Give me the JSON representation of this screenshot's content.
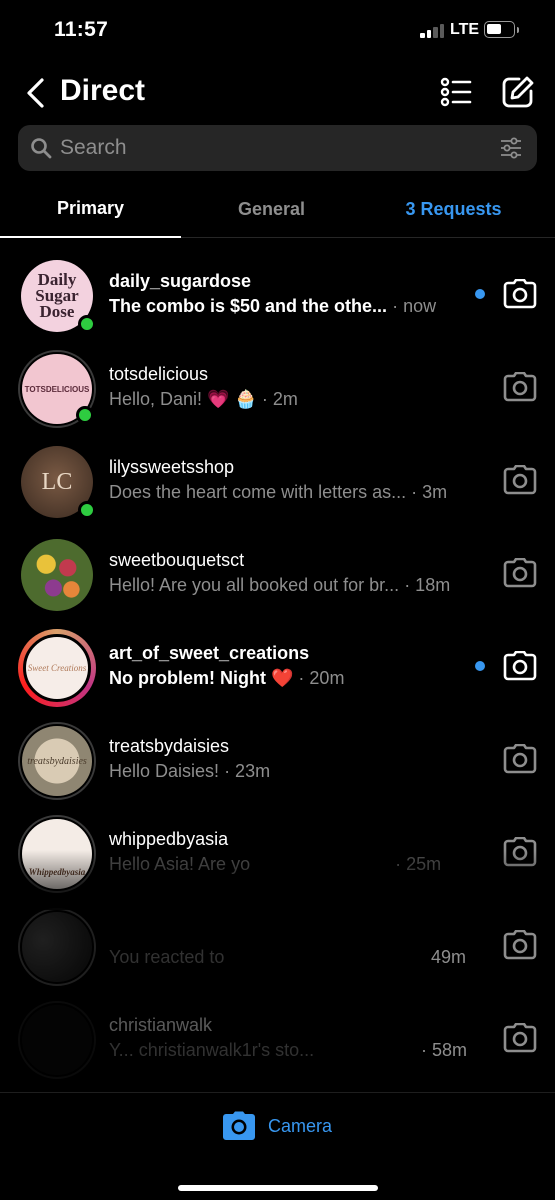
{
  "status_bar": {
    "time": "11:57",
    "network": "LTE"
  },
  "header": {
    "title": "Direct"
  },
  "search": {
    "placeholder": "Search"
  },
  "tabs": {
    "primary": "Primary",
    "general": "General",
    "requests": "3 Requests"
  },
  "threads": [
    {
      "username": "daily_sugardose",
      "preview": "The combo is $50 and the othe...",
      "time": "· now",
      "unread": true,
      "online": true,
      "avatar_text": "Daily Sugar Dose"
    },
    {
      "username": "totsdelicious",
      "preview": "Hello, Dani! 💗 🧁",
      "time": "· 2m",
      "unread": false,
      "online": true,
      "avatar_text": "TOTSDELICIOUS"
    },
    {
      "username": "lilyssweetsshop",
      "preview": "Does the heart come with letters as...",
      "time": "· 3m",
      "unread": false,
      "online": true,
      "avatar_text": "LC"
    },
    {
      "username": "sweetbouquetsct",
      "preview": "Hello! Are you all booked out for br...",
      "time": "· 18m",
      "unread": false,
      "online": false,
      "avatar_text": ""
    },
    {
      "username": "art_of_sweet_creations",
      "preview": "No problem! Night ❤️",
      "time": "· 20m",
      "unread": true,
      "online": false,
      "avatar_text": "Sweet Creations"
    },
    {
      "username": "treatsbydaisies",
      "preview": "Hello Daisies!",
      "time": "· 23m",
      "unread": false,
      "online": false,
      "avatar_text": "treatsbydaisies"
    },
    {
      "username": "whippedbyasia",
      "preview": "Hello Asia! Are yo",
      "time": "· 25m",
      "unread": false,
      "online": false,
      "avatar_text": "Whippedbyasia"
    },
    {
      "username": "",
      "preview": "You reacted to",
      "time": "49m",
      "unread": false,
      "online": false,
      "avatar_text": ""
    },
    {
      "username": "christianwalk",
      "preview": "Y... christianwalk1r's sto...",
      "time": "· 58m",
      "unread": false,
      "online": false,
      "avatar_text": ""
    }
  ],
  "bottom": {
    "camera_label": "Camera"
  },
  "colors": {
    "background": "#000000",
    "accent": "#3897f0",
    "online": "#2ecc40",
    "muted": "#8e8e8e"
  }
}
